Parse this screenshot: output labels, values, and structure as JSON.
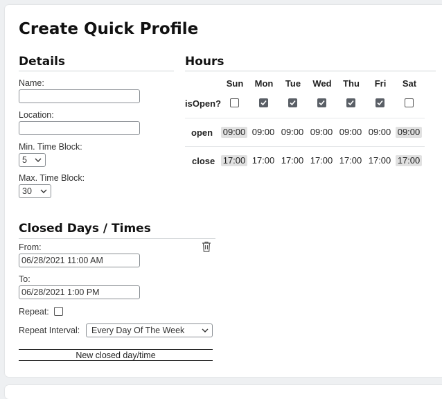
{
  "page": {
    "title": "Create Quick Profile"
  },
  "details": {
    "title": "Details",
    "name_label": "Name:",
    "name_value": "",
    "location_label": "Location:",
    "location_value": "",
    "min_block_label": "Min. Time Block:",
    "min_block_value": "5",
    "max_block_label": "Max. Time Block:",
    "max_block_value": "30"
  },
  "hours": {
    "title": "Hours",
    "days": [
      "Sun",
      "Mon",
      "Tue",
      "Wed",
      "Thu",
      "Fri",
      "Sat"
    ],
    "is_open_label": "isOpen?",
    "is_open": [
      false,
      true,
      true,
      true,
      true,
      true,
      false
    ],
    "open_label": "open",
    "open_times": [
      "09:00",
      "09:00",
      "09:00",
      "09:00",
      "09:00",
      "09:00",
      "09:00"
    ],
    "close_label": "close",
    "close_times": [
      "17:00",
      "17:00",
      "17:00",
      "17:00",
      "17:00",
      "17:00",
      "17:00"
    ]
  },
  "closed": {
    "title": "Closed Days / Times",
    "from_label": "From:",
    "from_value": "06/28/2021 11:00 AM",
    "to_label": "To:",
    "to_value": "06/28/2021 1:00 PM",
    "repeat_label": "Repeat:",
    "repeat_checked": false,
    "repeat_interval_label": "Repeat Interval:",
    "repeat_interval_value": "Every Day Of The Week",
    "delete_icon": "trash-icon",
    "new_button_label": "New closed day/time"
  },
  "colors": {
    "background": "#eef0f2",
    "card": "#ffffff",
    "checkbox_checked": "#5a5f66",
    "closed_day_highlight": "#e1e1e1"
  }
}
